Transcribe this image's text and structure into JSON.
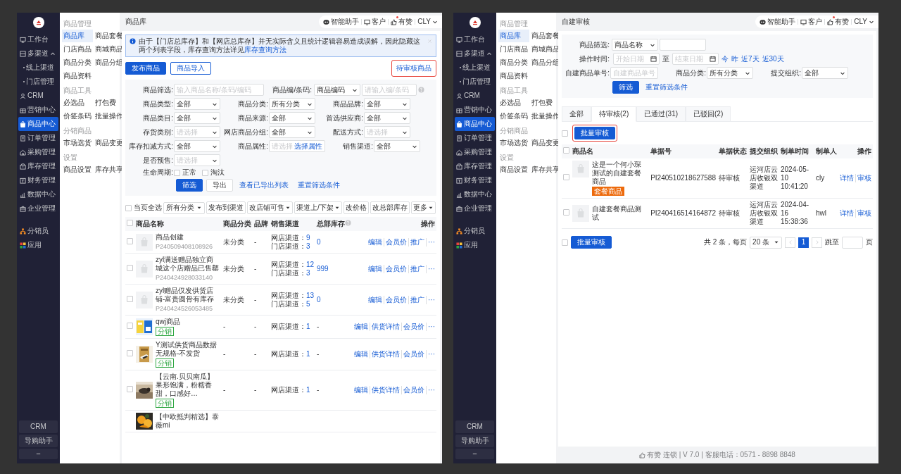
{
  "screens": [
    {
      "kind": "product_library",
      "sidebar": {
        "items": [
          {
            "label": "工作台",
            "selected": false
          },
          {
            "label": "多渠道",
            "selected": false,
            "expanded": true,
            "children": [
              {
                "label": "线上渠道",
                "selected": false
              },
              {
                "label": "门店管理",
                "selected": false
              }
            ]
          },
          {
            "label": "CRM",
            "selected": false
          },
          {
            "label": "营销中心",
            "selected": false
          },
          {
            "label": "商品中心",
            "selected": true
          },
          {
            "label": "订单管理",
            "selected": false
          },
          {
            "label": "采购管理",
            "selected": false
          },
          {
            "label": "库存管理",
            "selected": false
          },
          {
            "label": "财务管理",
            "selected": false
          },
          {
            "label": "数据中心",
            "selected": false
          },
          {
            "label": "企业管理",
            "selected": false
          }
        ],
        "apps": [
          {
            "label": "分销员",
            "selected": false
          },
          {
            "label": "应用",
            "selected": false
          }
        ],
        "bottom_buttons": [
          "CRM",
          "导购助手"
        ]
      },
      "submenu": [
        {
          "title": "商品管理",
          "items": [
            {
              "label": "商品库",
              "selected": true
            },
            {
              "label": "商品套餐",
              "selected": false
            },
            {
              "label": "门店商品",
              "selected": false
            },
            {
              "label": "商城商品",
              "selected": false
            },
            {
              "label": "商品分类",
              "selected": false
            },
            {
              "label": "商品分组",
              "selected": false
            },
            {
              "label": "商品资料",
              "selected": false
            }
          ]
        },
        {
          "title": "商品工具",
          "items": [
            {
              "label": "必选品",
              "selected": false
            },
            {
              "label": "打包费",
              "selected": false
            },
            {
              "label": "价签条码",
              "selected": false
            },
            {
              "label": "批量操作",
              "selected": false
            }
          ]
        },
        {
          "title": "分销商品",
          "items": [
            {
              "label": "市场选货",
              "selected": false
            },
            {
              "label": "商品变更",
              "selected": false
            }
          ]
        },
        {
          "title": "设置",
          "items": [
            {
              "label": "商品设置",
              "selected": false
            },
            {
              "label": "库存共享",
              "selected": false
            }
          ]
        }
      ],
      "header": {
        "title": "商品库",
        "assistant": "智能助手",
        "customer": "客户",
        "like": {
          "label": "有赞",
          "notify": true
        },
        "user": "CLY"
      },
      "notice": {
        "text": "由于【门店总库存】和【网店总库存】并无实际含义且统计逻辑容易造成误解，因此隐藏这两个列表字段，库存查询方法详见",
        "link": "库存查询方法"
      },
      "actions": [
        {
          "label": "发布商品",
          "kind": "primary",
          "highlighted": false
        },
        {
          "label": "商品导入",
          "kind": "outline",
          "highlighted": false
        }
      ],
      "side_action": {
        "label": "待审核商品",
        "kind": "link",
        "highlighted": true
      },
      "filters": [
        [
          {
            "label": "商品筛选:",
            "kind": "input",
            "placeholder": "输入商品名称/条码/编码"
          },
          {
            "label": "商品编/条码:",
            "kind": "select_input",
            "value": "商品编码",
            "placeholder": "请输入编/条码",
            "help": true
          }
        ],
        [
          {
            "label": "商品类型:",
            "kind": "select",
            "value": "全部"
          },
          {
            "label": "商品分类:",
            "kind": "select",
            "value": "所有分类"
          },
          {
            "label": "商品品牌:",
            "kind": "select",
            "value": "全部"
          }
        ],
        [
          {
            "label": "商品类目:",
            "kind": "select",
            "value": "全部"
          },
          {
            "label": "商品来源:",
            "kind": "select",
            "value": "全部"
          },
          {
            "label": "首选供应商:",
            "kind": "select",
            "value": "全部"
          }
        ],
        [
          {
            "label": "存货类别:",
            "kind": "select",
            "placeholder": "请选择"
          },
          {
            "label": "网店商品分组:",
            "kind": "select",
            "value": "全部"
          },
          {
            "label": "配送方式:",
            "kind": "select",
            "placeholder": "请选择"
          }
        ],
        [
          {
            "label": "库存扣减方式:",
            "kind": "select",
            "value": "全部"
          },
          {
            "label": "商品属性:",
            "kind": "attribute",
            "placeholder": "请选择",
            "link": "选择属性"
          },
          {
            "label": "销售渠道:",
            "kind": "select",
            "value": "全部"
          }
        ],
        [
          {
            "label": "是否预售:",
            "kind": "select",
            "placeholder": "请选择"
          }
        ],
        [
          {
            "label": "生命周期:",
            "kind": "checks",
            "options": [
              {
                "label": "正常",
                "checked": false
              },
              {
                "label": "淘汰",
                "checked": false
              }
            ]
          }
        ]
      ],
      "filter_actions": [
        {
          "label": "筛选",
          "kind": "primary"
        },
        {
          "label": "导出",
          "kind": "default"
        },
        {
          "label": "查看已导出列表",
          "kind": "link"
        },
        {
          "label": "重置筛选条件",
          "kind": "link"
        }
      ],
      "bulk_bar": {
        "select_all": {
          "label": "当页全选",
          "checked": false
        },
        "controls": [
          {
            "label": "所有分类",
            "kind": "select"
          },
          {
            "label": "发布到渠道",
            "kind": "button"
          },
          {
            "label": "改店铺可售",
            "kind": "dropdown"
          },
          {
            "label": "渠道上/下架",
            "kind": "dropdown"
          },
          {
            "label": "改价格",
            "kind": "button"
          },
          {
            "label": "改总部库存",
            "kind": "button"
          },
          {
            "label": "更多",
            "kind": "dropdown"
          }
        ]
      },
      "table": {
        "header_checked": false,
        "columns": [
          {
            "label": "商品名称"
          },
          {
            "label": "商品分类"
          },
          {
            "label": "品牌"
          },
          {
            "label": "销售渠道"
          },
          {
            "label": "总部库存",
            "help": true
          },
          {
            "label": "操作"
          }
        ],
        "rows": [
          {
            "checked": false,
            "kind": "placeholder",
            "name": "商品创建",
            "code": "P240509408108926",
            "category": "未分类",
            "brand": "-",
            "channels": [
              {
                "label": "网店渠道：",
                "value": "9"
              },
              {
                "label": "门店渠道：",
                "value": "3"
              }
            ],
            "stock": "0",
            "stock_link": true,
            "ops": [
              "编辑",
              "会员价",
              "推广",
              "···"
            ]
          },
          {
            "checked": false,
            "kind": "placeholder",
            "name": "zyl满送赠品独立商城这个店赠品已售罄",
            "code": "P240424928033140",
            "category": "未分类",
            "brand": "-",
            "channels": [
              {
                "label": "网店渠道：",
                "value": "12"
              },
              {
                "label": "门店渠道：",
                "value": "3"
              }
            ],
            "stock": "999",
            "stock_link": true,
            "ops": [
              "编辑",
              "会员价",
              "推广",
              "···"
            ]
          },
          {
            "checked": false,
            "kind": "placeholder",
            "name": "zyl赠品仅发供货店铺-富贵圆骨有库存",
            "code": "P240424526053485",
            "category": "未分类",
            "brand": "-",
            "channels": [
              {
                "label": "网店渠道：",
                "value": "13"
              },
              {
                "label": "门店渠道：",
                "value": "5"
              }
            ],
            "stock": "0",
            "stock_link": true,
            "ops": [
              "编辑",
              "会员价",
              "推广",
              "···"
            ]
          },
          {
            "checked": false,
            "kind": "picture",
            "name": "qwj商品",
            "tag": {
              "label": "分销",
              "kind": "distribution"
            },
            "category": "-",
            "brand": "-",
            "channels": [
              {
                "label": "网店渠道：",
                "value": "1"
              }
            ],
            "stock": "-",
            "stock_link": false,
            "ops": [
              "编辑",
              "供货详情",
              "会员价",
              "···"
            ]
          },
          {
            "checked": false,
            "kind": "picture",
            "name": "Y测试供货商品数据无规格-不发货",
            "tag": {
              "label": "分销",
              "kind": "distribution"
            },
            "category": "-",
            "brand": "-",
            "channels": [
              {
                "label": "网店渠道：",
                "value": "1"
              }
            ],
            "stock": "-",
            "stock_link": false,
            "ops": [
              "编辑",
              "供货详情",
              "会员价",
              "···"
            ]
          },
          {
            "checked": false,
            "kind": "picture",
            "name": "【云南.贝贝南瓜】果形饱满，粉糯香甜，口感好…",
            "tag": {
              "label": "分销",
              "kind": "distribution"
            },
            "category": "-",
            "brand": "-",
            "channels": [
              {
                "label": "网店渠道：",
                "value": "1"
              }
            ],
            "stock": "-",
            "stock_link": false,
            "ops": [
              "编辑",
              "供货详情",
              "会员价",
              "···"
            ]
          },
          {
            "kind": "picture",
            "name": "【中欧抵判精选】泰薇mi"
          }
        ]
      }
    },
    {
      "kind": "review",
      "sidebar": {
        "items": [
          {
            "label": "工作台",
            "selected": false
          },
          {
            "label": "多渠道",
            "selected": false,
            "expanded": true,
            "children": [
              {
                "label": "线上渠道",
                "selected": false
              },
              {
                "label": "门店管理",
                "selected": false
              }
            ]
          },
          {
            "label": "CRM",
            "selected": false
          },
          {
            "label": "营销中心",
            "selected": false
          },
          {
            "label": "商品中心",
            "selected": true
          },
          {
            "label": "订单管理",
            "selected": false
          },
          {
            "label": "采购管理",
            "selected": false
          },
          {
            "label": "库存管理",
            "selected": false
          },
          {
            "label": "财务管理",
            "selected": false
          },
          {
            "label": "数据中心",
            "selected": false
          },
          {
            "label": "企业管理",
            "selected": false
          }
        ],
        "apps": [
          {
            "label": "分销员",
            "selected": false
          },
          {
            "label": "应用",
            "selected": false
          }
        ],
        "bottom_buttons": [
          "CRM",
          "导购助手"
        ]
      },
      "submenu": [
        {
          "title": "商品管理",
          "items": [
            {
              "label": "商品库",
              "selected": true
            },
            {
              "label": "商品套餐",
              "selected": false
            },
            {
              "label": "门店商品",
              "selected": false
            },
            {
              "label": "商城商品",
              "selected": false
            },
            {
              "label": "商品分类",
              "selected": false
            },
            {
              "label": "商品分组",
              "selected": false
            },
            {
              "label": "商品资料",
              "selected": false
            }
          ]
        },
        {
          "title": "商品工具",
          "items": [
            {
              "label": "必选品",
              "selected": false
            },
            {
              "label": "打包费",
              "selected": false
            },
            {
              "label": "价签条码",
              "selected": false
            },
            {
              "label": "批量操作",
              "selected": false
            }
          ]
        },
        {
          "title": "分销商品",
          "items": [
            {
              "label": "市场选货",
              "selected": false
            },
            {
              "label": "商品变更",
              "selected": false
            }
          ]
        },
        {
          "title": "设置",
          "items": [
            {
              "label": "商品设置",
              "selected": false
            },
            {
              "label": "库存共享",
              "selected": false
            }
          ]
        }
      ],
      "header": {
        "title": "自建审核",
        "assistant": "智能助手",
        "customer": "客户",
        "like": {
          "label": "有赞",
          "notify": true
        },
        "user": "CLY"
      },
      "filters": [
        [
          {
            "label": "商品筛选:",
            "kind": "select_input",
            "value": "商品名称"
          }
        ],
        [
          {
            "label": "操作时间:",
            "kind": "date_range",
            "start_placeholder": "开始日期",
            "separator": "至",
            "end_placeholder": "结束日期",
            "shortcuts": [
              "今",
              "昨",
              "近7天",
              "近30天"
            ]
          }
        ],
        [
          {
            "label": "自建商品单号:",
            "kind": "input",
            "placeholder": "自建商品单号"
          },
          {
            "label": "商品分类:",
            "kind": "select",
            "value": "所有分类"
          },
          {
            "label": "提交组织:",
            "kind": "select",
            "value": "全部"
          }
        ]
      ],
      "filter_actions": [
        {
          "label": "筛选",
          "kind": "primary"
        },
        {
          "label": "重置筛选条件",
          "kind": "link"
        }
      ],
      "tabs": [
        {
          "label": "全部",
          "selected": false
        },
        {
          "label": "待审核(2)",
          "selected": true
        },
        {
          "label": "已通过(31)",
          "selected": false
        },
        {
          "label": "已驳回(2)",
          "selected": false
        }
      ],
      "bulk": {
        "checked": false,
        "button": {
          "label": "批量审核",
          "highlighted": true
        }
      },
      "table": {
        "header_checked": false,
        "columns": [
          {
            "label": "商品名"
          },
          {
            "label": "单据号"
          },
          {
            "label": "单据状态"
          },
          {
            "label": "提交组织"
          },
          {
            "label": "制单时间"
          },
          {
            "label": "制单人"
          },
          {
            "label": "操作"
          }
        ],
        "rows": [
          {
            "checked": false,
            "name": "这是一个何小琛测试的自建套餐商品",
            "tag": {
              "label": "套餐商品",
              "kind": "combo"
            },
            "doc_no": "PI240510218627588",
            "status": "待审核",
            "org": "运河店云店收银双渠道",
            "time": "2024-05-10 10:41:20",
            "maker": "cly",
            "ops": [
              "详情",
              "审核"
            ]
          },
          {
            "checked": false,
            "name": "自建套餐商品测试",
            "doc_no": "PI240416514164872",
            "status": "待审核",
            "org": "运河店云店收银双渠道",
            "time": "2024-04-16 15:38:36",
            "maker": "hwl",
            "ops": [
              "详情",
              "审核"
            ]
          }
        ]
      },
      "pager": {
        "checked": false,
        "button": {
          "label": "批量审核"
        },
        "total": "共 2 条，每页",
        "page_size": "20 条",
        "pages": [
          {
            "label": "1",
            "selected": true
          }
        ],
        "jump": "跳至",
        "unit": "页"
      },
      "footer": "有赞 连锁 | V 7.0 | 客服电话：0571 - 8898 8848"
    }
  ]
}
